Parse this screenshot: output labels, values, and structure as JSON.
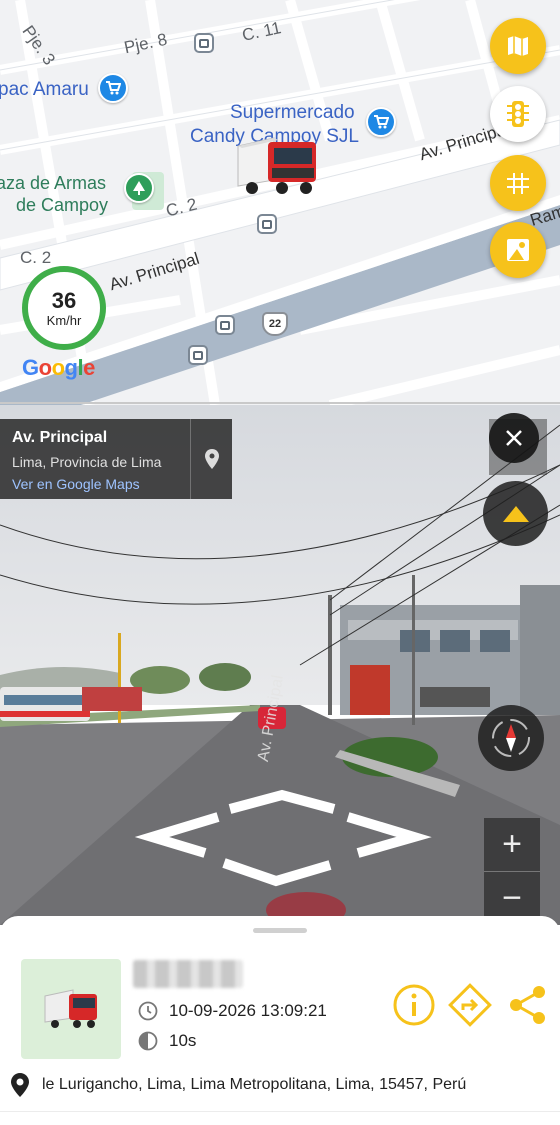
{
  "map": {
    "labels": {
      "pje3": "Pje. 3",
      "pje8": "Pje. 8",
      "c11": "C. 11",
      "tupac": "pac Amaru",
      "supermercado_1": "Supermercado",
      "supermercado_2": "Candy Campoy SJL",
      "av_principal_top": "Av. Principal",
      "plaza_1": "aza de Armas",
      "plaza_2": "de Campoy",
      "c2_a": "C. 2",
      "c2_b": "C. 2",
      "av_principal_bottom": "Av. Principal",
      "ramiro": "Ram",
      "route_number": "22"
    },
    "google_logo": "Google",
    "speed": {
      "value": "36",
      "unit": "Km/hr"
    }
  },
  "street_view": {
    "title": "Av. Principal",
    "subtitle": "Lima, Provincia de Lima",
    "link": "Ver en Google Maps",
    "road_text": "Av. Principal",
    "zoom_in": "+",
    "zoom_out": "−"
  },
  "vehicle": {
    "datetime": "10-09-2026 13:09:21",
    "duration": "10s",
    "address": "le Lurigancho, Lima, Lima Metropolitana, Lima, 15457, Perú"
  },
  "colors": {
    "accent": "#f6c21b",
    "speed_ring": "#3fae49",
    "road_main": "#aab8c8"
  }
}
